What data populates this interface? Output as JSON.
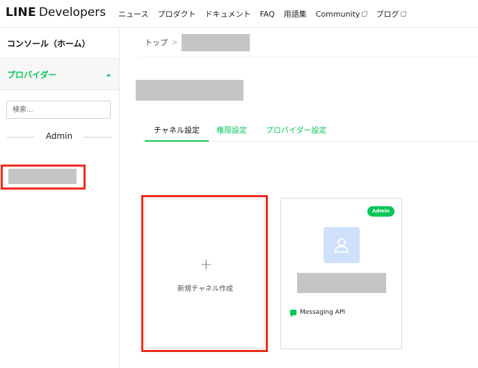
{
  "header": {
    "logo_line": "LINE",
    "logo_dev": "Developers",
    "nav": [
      {
        "label": "ニュース"
      },
      {
        "label": "プロダクト"
      },
      {
        "label": "ドキュメント"
      },
      {
        "label": "FAQ"
      },
      {
        "label": "用語集"
      },
      {
        "label": "Community",
        "external": true
      },
      {
        "label": "ブログ",
        "external": true
      }
    ]
  },
  "sidebar": {
    "console_label": "コンソール（ホーム）",
    "provider_label": "プロバイダー",
    "search_placeholder": "検索...",
    "admin_label": "Admin"
  },
  "breadcrumb": {
    "home": "トップ",
    "separator": ">"
  },
  "tabs": [
    {
      "label": "チャネル設定",
      "active": true
    },
    {
      "label": "権限設定",
      "active": false
    },
    {
      "label": "プロバイダー設定",
      "active": false
    }
  ],
  "new_channel": {
    "plus": "+",
    "label": "新規チャネル作成"
  },
  "channel_card": {
    "badge": "Admin",
    "type": "Messaging API"
  },
  "colors": {
    "accent": "#06c755",
    "highlight": "#ee2a1b",
    "redacted": "#c5c5c5",
    "avatar_bg": "#cfe1fb"
  }
}
